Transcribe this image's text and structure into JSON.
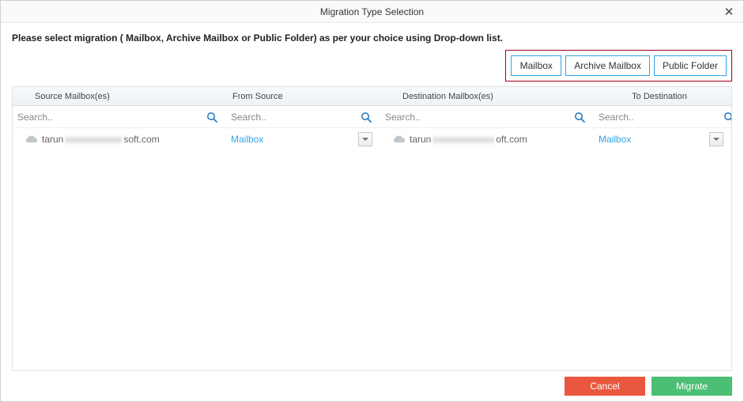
{
  "window": {
    "title": "Migration Type Selection"
  },
  "instructions": "Please select migration ( Mailbox, Archive Mailbox or Public Folder) as per your choice using Drop-down list.",
  "typeButtons": {
    "mailbox": "Mailbox",
    "archive": "Archive Mailbox",
    "public": "Public Folder"
  },
  "columns": {
    "sourceMailbox": "Source Mailbox(es)",
    "fromSource": "From Source",
    "destMailbox": "Destination Mailbox(es)",
    "toDestination": "To Destination"
  },
  "search": {
    "placeholder": "Search.."
  },
  "rows": [
    {
      "sourcePrefix": "tarun",
      "sourceBlur": "xxxxxxxxxxxx",
      "sourceSuffix": "soft.com",
      "fromSource": "Mailbox",
      "destPrefix": "tarun",
      "destBlur": "xxxxxxxxxxxxx",
      "destSuffix": "oft.com",
      "toDestination": "Mailbox"
    }
  ],
  "footer": {
    "cancel": "Cancel",
    "migrate": "Migrate"
  }
}
